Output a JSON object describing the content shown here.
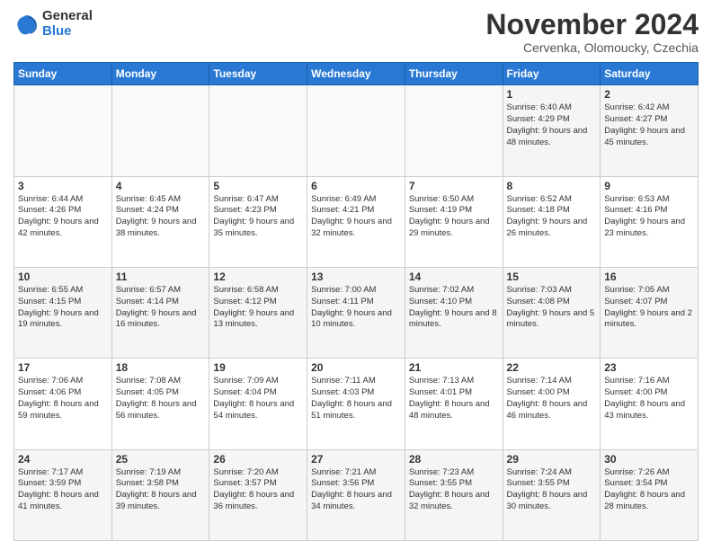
{
  "logo": {
    "general": "General",
    "blue": "Blue"
  },
  "title": "November 2024",
  "subtitle": "Cervenka, Olomoucky, Czechia",
  "days_header": [
    "Sunday",
    "Monday",
    "Tuesday",
    "Wednesday",
    "Thursday",
    "Friday",
    "Saturday"
  ],
  "weeks": [
    [
      {
        "day": "",
        "info": ""
      },
      {
        "day": "",
        "info": ""
      },
      {
        "day": "",
        "info": ""
      },
      {
        "day": "",
        "info": ""
      },
      {
        "day": "",
        "info": ""
      },
      {
        "day": "1",
        "info": "Sunrise: 6:40 AM\nSunset: 4:29 PM\nDaylight: 9 hours\nand 48 minutes."
      },
      {
        "day": "2",
        "info": "Sunrise: 6:42 AM\nSunset: 4:27 PM\nDaylight: 9 hours\nand 45 minutes."
      }
    ],
    [
      {
        "day": "3",
        "info": "Sunrise: 6:44 AM\nSunset: 4:26 PM\nDaylight: 9 hours\nand 42 minutes."
      },
      {
        "day": "4",
        "info": "Sunrise: 6:45 AM\nSunset: 4:24 PM\nDaylight: 9 hours\nand 38 minutes."
      },
      {
        "day": "5",
        "info": "Sunrise: 6:47 AM\nSunset: 4:23 PM\nDaylight: 9 hours\nand 35 minutes."
      },
      {
        "day": "6",
        "info": "Sunrise: 6:49 AM\nSunset: 4:21 PM\nDaylight: 9 hours\nand 32 minutes."
      },
      {
        "day": "7",
        "info": "Sunrise: 6:50 AM\nSunset: 4:19 PM\nDaylight: 9 hours\nand 29 minutes."
      },
      {
        "day": "8",
        "info": "Sunrise: 6:52 AM\nSunset: 4:18 PM\nDaylight: 9 hours\nand 26 minutes."
      },
      {
        "day": "9",
        "info": "Sunrise: 6:53 AM\nSunset: 4:16 PM\nDaylight: 9 hours\nand 23 minutes."
      }
    ],
    [
      {
        "day": "10",
        "info": "Sunrise: 6:55 AM\nSunset: 4:15 PM\nDaylight: 9 hours\nand 19 minutes."
      },
      {
        "day": "11",
        "info": "Sunrise: 6:57 AM\nSunset: 4:14 PM\nDaylight: 9 hours\nand 16 minutes."
      },
      {
        "day": "12",
        "info": "Sunrise: 6:58 AM\nSunset: 4:12 PM\nDaylight: 9 hours\nand 13 minutes."
      },
      {
        "day": "13",
        "info": "Sunrise: 7:00 AM\nSunset: 4:11 PM\nDaylight: 9 hours\nand 10 minutes."
      },
      {
        "day": "14",
        "info": "Sunrise: 7:02 AM\nSunset: 4:10 PM\nDaylight: 9 hours\nand 8 minutes."
      },
      {
        "day": "15",
        "info": "Sunrise: 7:03 AM\nSunset: 4:08 PM\nDaylight: 9 hours\nand 5 minutes."
      },
      {
        "day": "16",
        "info": "Sunrise: 7:05 AM\nSunset: 4:07 PM\nDaylight: 9 hours\nand 2 minutes."
      }
    ],
    [
      {
        "day": "17",
        "info": "Sunrise: 7:06 AM\nSunset: 4:06 PM\nDaylight: 8 hours\nand 59 minutes."
      },
      {
        "day": "18",
        "info": "Sunrise: 7:08 AM\nSunset: 4:05 PM\nDaylight: 8 hours\nand 56 minutes."
      },
      {
        "day": "19",
        "info": "Sunrise: 7:09 AM\nSunset: 4:04 PM\nDaylight: 8 hours\nand 54 minutes."
      },
      {
        "day": "20",
        "info": "Sunrise: 7:11 AM\nSunset: 4:03 PM\nDaylight: 8 hours\nand 51 minutes."
      },
      {
        "day": "21",
        "info": "Sunrise: 7:13 AM\nSunset: 4:01 PM\nDaylight: 8 hours\nand 48 minutes."
      },
      {
        "day": "22",
        "info": "Sunrise: 7:14 AM\nSunset: 4:00 PM\nDaylight: 8 hours\nand 46 minutes."
      },
      {
        "day": "23",
        "info": "Sunrise: 7:16 AM\nSunset: 4:00 PM\nDaylight: 8 hours\nand 43 minutes."
      }
    ],
    [
      {
        "day": "24",
        "info": "Sunrise: 7:17 AM\nSunset: 3:59 PM\nDaylight: 8 hours\nand 41 minutes."
      },
      {
        "day": "25",
        "info": "Sunrise: 7:19 AM\nSunset: 3:58 PM\nDaylight: 8 hours\nand 39 minutes."
      },
      {
        "day": "26",
        "info": "Sunrise: 7:20 AM\nSunset: 3:57 PM\nDaylight: 8 hours\nand 36 minutes."
      },
      {
        "day": "27",
        "info": "Sunrise: 7:21 AM\nSunset: 3:56 PM\nDaylight: 8 hours\nand 34 minutes."
      },
      {
        "day": "28",
        "info": "Sunrise: 7:23 AM\nSunset: 3:55 PM\nDaylight: 8 hours\nand 32 minutes."
      },
      {
        "day": "29",
        "info": "Sunrise: 7:24 AM\nSunset: 3:55 PM\nDaylight: 8 hours\nand 30 minutes."
      },
      {
        "day": "30",
        "info": "Sunrise: 7:26 AM\nSunset: 3:54 PM\nDaylight: 8 hours\nand 28 minutes."
      }
    ]
  ]
}
